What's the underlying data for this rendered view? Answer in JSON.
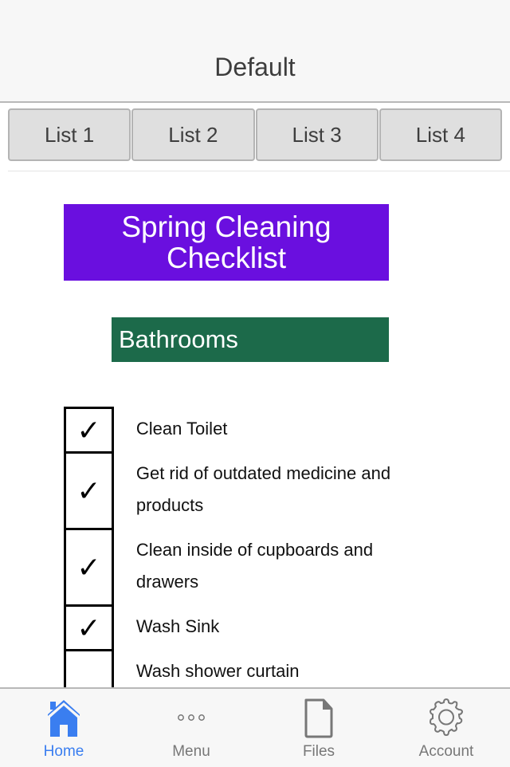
{
  "nav": {
    "title": "Default"
  },
  "tabs": [
    {
      "label": "List 1"
    },
    {
      "label": "List 2"
    },
    {
      "label": "List 3"
    },
    {
      "label": "List 4"
    }
  ],
  "content": {
    "title": "Spring Cleaning Checklist",
    "title_line1": "Spring Cleaning",
    "title_line2": "Checklist",
    "title_color": "#6a0fdf",
    "section": "Bathrooms",
    "section_color": "#1c6a4a",
    "checkmark": "✓",
    "items": [
      {
        "label": "Clean Toilet",
        "checked": true
      },
      {
        "label": "Get rid of outdated medicine and products",
        "checked": true
      },
      {
        "label": "Clean inside of cupboards and drawers",
        "checked": true
      },
      {
        "label": "Wash Sink",
        "checked": true
      },
      {
        "label": "Wash shower curtain",
        "checked": false
      }
    ]
  },
  "tabbar": {
    "active_color": "#3a7ef0",
    "inactive_color": "#777777",
    "items": [
      {
        "label": "Home",
        "icon": "home-icon",
        "active": true
      },
      {
        "label": "Menu",
        "icon": "more-dots-icon",
        "active": false
      },
      {
        "label": "Files",
        "icon": "file-icon",
        "active": false
      },
      {
        "label": "Account",
        "icon": "gear-icon",
        "active": false
      }
    ]
  }
}
